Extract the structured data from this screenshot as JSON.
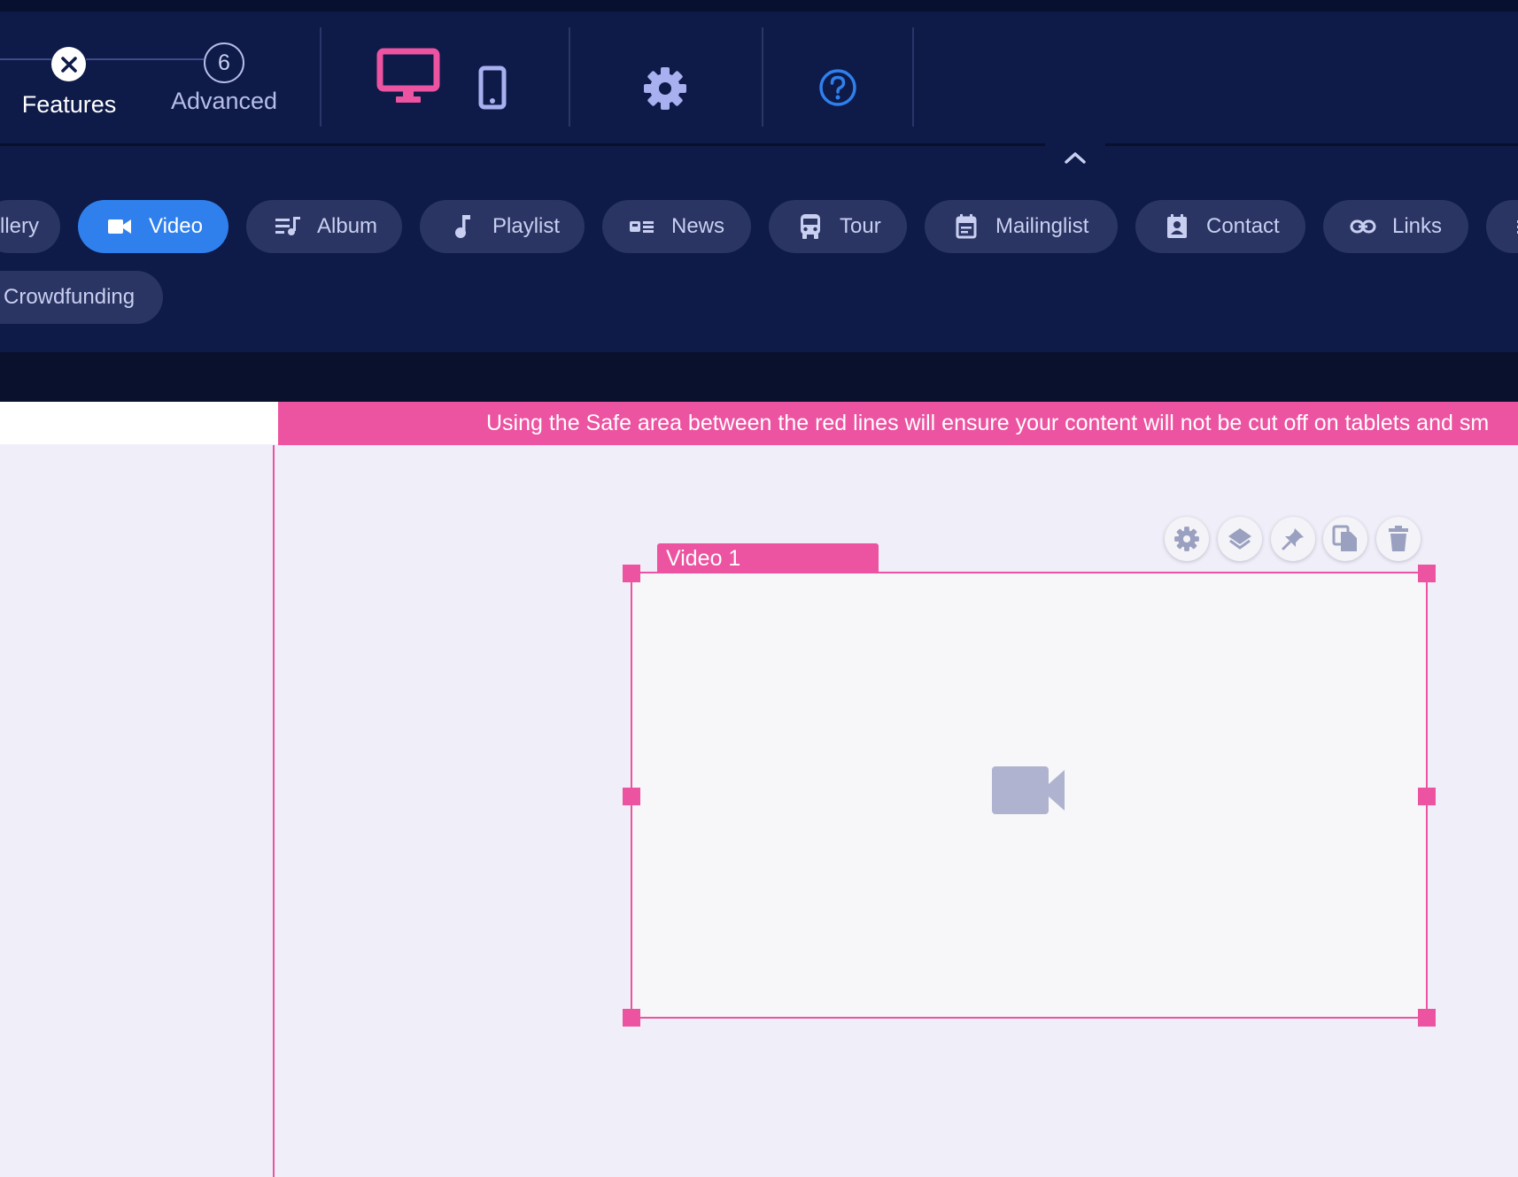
{
  "header": {
    "steps": [
      {
        "label": "Features",
        "state": "current"
      },
      {
        "number": "6",
        "label": "Advanced"
      }
    ],
    "device_toggle": {
      "desktop_icon": "desktop-icon",
      "mobile_icon": "mobile-icon",
      "active": "desktop"
    },
    "settings_icon": "gear-icon",
    "help_icon": "help-icon",
    "collapse_icon": "chevron-up-icon"
  },
  "features": {
    "chips": [
      {
        "label": "llery",
        "icon": "gallery-icon"
      },
      {
        "label": "Video",
        "icon": "videocam-icon",
        "active": true
      },
      {
        "label": "Album",
        "icon": "album-icon"
      },
      {
        "label": "Playlist",
        "icon": "music-note-icon"
      },
      {
        "label": "News",
        "icon": "news-icon"
      },
      {
        "label": "Tour",
        "icon": "bus-icon"
      },
      {
        "label": "Mailinglist",
        "icon": "calendar-icon"
      },
      {
        "label": "Contact",
        "icon": "contact-icon"
      },
      {
        "label": "Links",
        "icon": "link-icon"
      },
      {
        "label": "",
        "icon": "more-icon"
      },
      {
        "label": "Crowdfunding",
        "icon": "crowdfunding-icon"
      }
    ]
  },
  "canvas": {
    "safe_area_notice": "Using the Safe area between the red lines will ensure your content will not be cut off on tablets and sm",
    "widget": {
      "title": "Video 1",
      "placeholder_icon": "videocam-icon",
      "toolbar": [
        "gear-icon",
        "layers-icon",
        "pin-icon",
        "copy-icon",
        "delete-icon"
      ]
    }
  },
  "colors": {
    "header_bg": "#0e1a48",
    "chip_bg": "#2a3563",
    "active_chip": "#2f80ed",
    "accent_pink": "#ec53a0",
    "help_blue": "#2f80ed",
    "icon_lavender": "#a8b0f0"
  }
}
